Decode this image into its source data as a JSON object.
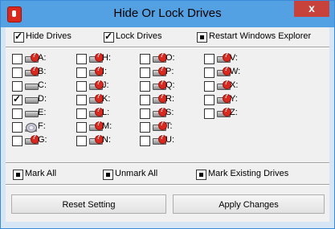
{
  "window": {
    "title": "Hide Or Lock Drives",
    "close_glyph": "x"
  },
  "options": {
    "hide_drives": {
      "label": "Hide Drives",
      "checked": true
    },
    "lock_drives": {
      "label": "Lock Drives",
      "checked": true
    },
    "restart_explorer": {
      "label": "Restart Windows Explorer",
      "checked": true
    }
  },
  "drives": [
    {
      "label": "A:",
      "checked": false,
      "icon": "locked-drive-icon"
    },
    {
      "label": "B:",
      "checked": false,
      "icon": "locked-drive-icon"
    },
    {
      "label": "C:",
      "checked": false,
      "icon": "hard-drive-icon"
    },
    {
      "label": "D:",
      "checked": true,
      "icon": "hard-drive-icon"
    },
    {
      "label": "E:",
      "checked": false,
      "icon": "hard-drive-icon"
    },
    {
      "label": "F:",
      "checked": false,
      "icon": "cd-drive-icon"
    },
    {
      "label": "G:",
      "checked": false,
      "icon": "locked-drive-icon"
    },
    {
      "label": "H:",
      "checked": false,
      "icon": "locked-drive-icon"
    },
    {
      "label": "I:",
      "checked": false,
      "icon": "locked-drive-icon"
    },
    {
      "label": "J:",
      "checked": false,
      "icon": "locked-drive-icon"
    },
    {
      "label": "K:",
      "checked": false,
      "icon": "locked-drive-icon"
    },
    {
      "label": "L:",
      "checked": false,
      "icon": "locked-drive-icon"
    },
    {
      "label": "M:",
      "checked": false,
      "icon": "locked-drive-icon"
    },
    {
      "label": "N:",
      "checked": false,
      "icon": "locked-drive-icon"
    },
    {
      "label": "O:",
      "checked": false,
      "icon": "locked-drive-icon"
    },
    {
      "label": "P:",
      "checked": false,
      "icon": "locked-drive-icon"
    },
    {
      "label": "Q:",
      "checked": false,
      "icon": "locked-drive-icon"
    },
    {
      "label": "R:",
      "checked": false,
      "icon": "locked-drive-icon"
    },
    {
      "label": "S:",
      "checked": false,
      "icon": "locked-drive-icon"
    },
    {
      "label": "T:",
      "checked": false,
      "icon": "locked-drive-icon"
    },
    {
      "label": "U:",
      "checked": false,
      "icon": "locked-drive-icon"
    },
    {
      "label": "V:",
      "checked": false,
      "icon": "locked-drive-icon"
    },
    {
      "label": "W:",
      "checked": false,
      "icon": "locked-drive-icon"
    },
    {
      "label": "X:",
      "checked": false,
      "icon": "locked-drive-icon"
    },
    {
      "label": "Y:",
      "checked": false,
      "icon": "locked-drive-icon"
    },
    {
      "label": "Z:",
      "checked": false,
      "icon": "locked-drive-icon"
    }
  ],
  "mark": {
    "mark_all": "Mark All",
    "unmark_all": "Unmark All",
    "mark_existing": "Mark Existing Drives"
  },
  "buttons": {
    "reset": "Reset Setting",
    "apply": "Apply Changes"
  },
  "colors": {
    "titlebar": "#53a0e2",
    "close": "#c7423a",
    "lock_badge": "#d82a20"
  }
}
